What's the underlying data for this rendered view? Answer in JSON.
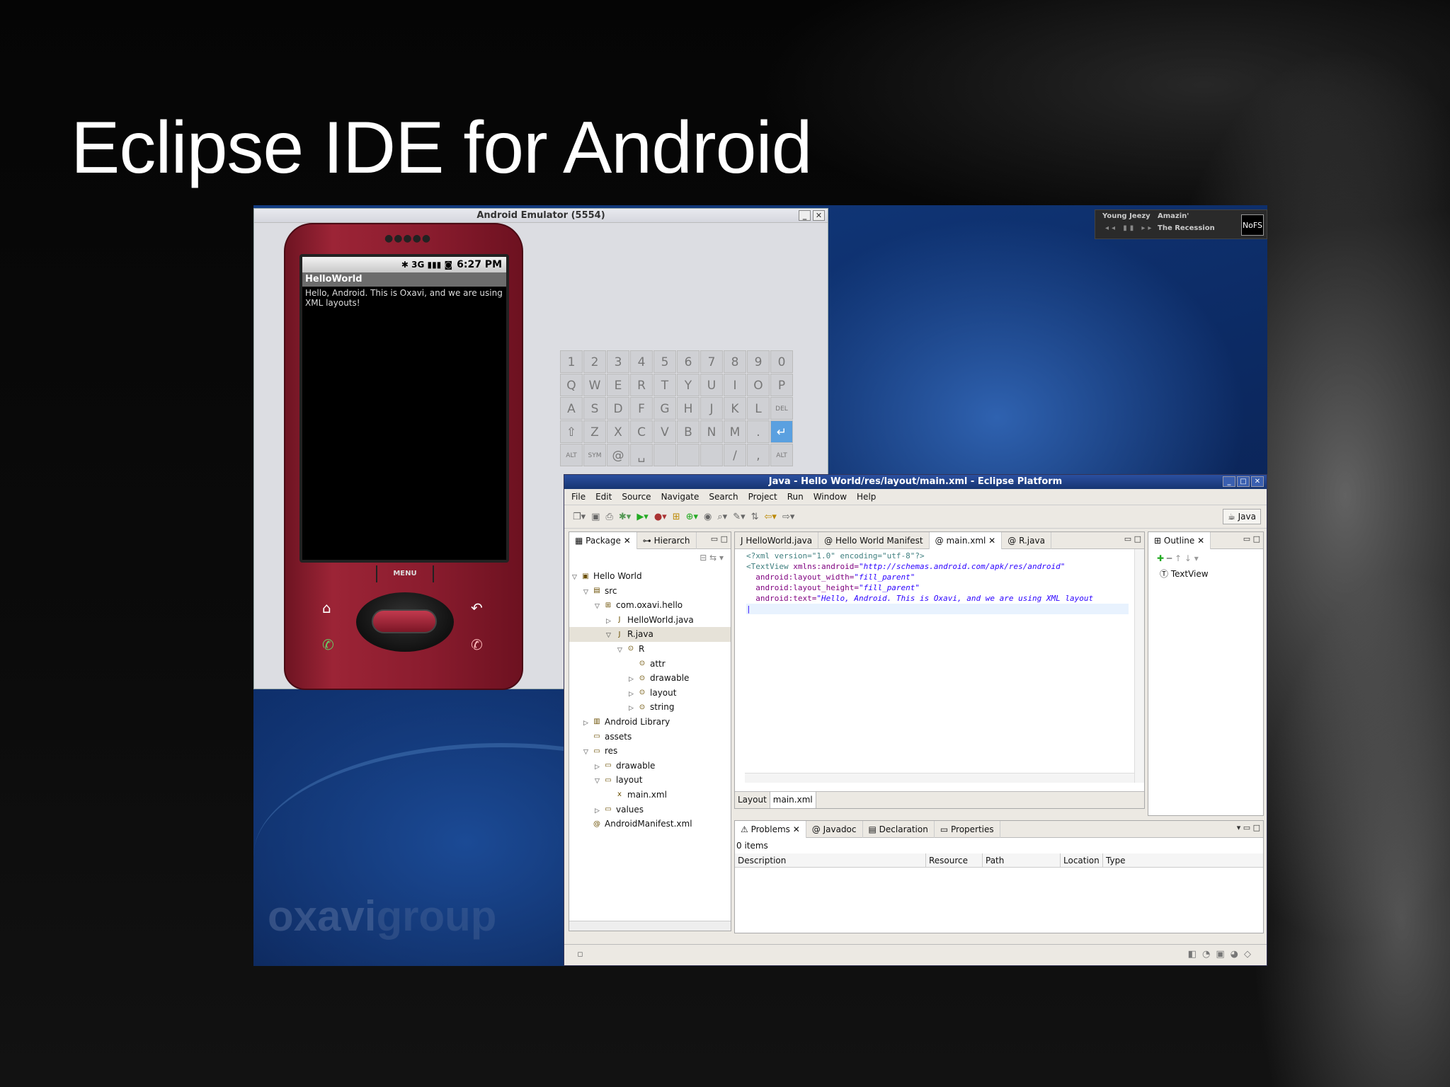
{
  "slide": {
    "title": "Eclipse IDE for Android"
  },
  "music": {
    "artist": "Young Jeezy",
    "song": "Amazin'",
    "album": "The Recession",
    "logo": "NoFS",
    "controls": "◂◂ ▮▮ ▸▸"
  },
  "brand": {
    "part1": "oxavi",
    "part2": "group"
  },
  "emulator": {
    "title": "Android Emulator (5554)",
    "time": "6:27 PM",
    "status_icons": "✱ 3G ▮▮▮ ◙",
    "app_title": "HelloWorld",
    "app_text": "Hello, Android. This is Oxavi, and we are using XML layouts!",
    "menu_label": "MENU",
    "keys": [
      [
        "1",
        "2",
        "3",
        "4",
        "5",
        "6",
        "7",
        "8",
        "9",
        "0"
      ],
      [
        "Q",
        "W",
        "E",
        "R",
        "T",
        "Y",
        "U",
        "I",
        "O",
        "P"
      ],
      [
        "A",
        "S",
        "D",
        "F",
        "G",
        "H",
        "J",
        "K",
        "L",
        "DEL"
      ],
      [
        "⇧",
        "Z",
        "X",
        "C",
        "V",
        "B",
        "N",
        "M",
        ".",
        "↵"
      ],
      [
        "ALT",
        "SYM",
        "@",
        "␣",
        "",
        "",
        "",
        "/",
        ",",
        "ALT"
      ]
    ]
  },
  "eclipse": {
    "title": "Java - Hello World/res/layout/main.xml - Eclipse Platform",
    "menu": [
      "File",
      "Edit",
      "Source",
      "Navigate",
      "Search",
      "Project",
      "Run",
      "Window",
      "Help"
    ],
    "perspective": "Java",
    "left_tabs": [
      "Package",
      "Hierarch"
    ],
    "tree": [
      {
        "level": 0,
        "twisty": "▽",
        "icon": "▣",
        "label": "Hello World"
      },
      {
        "level": 1,
        "twisty": "▽",
        "icon": "▤",
        "label": "src"
      },
      {
        "level": 2,
        "twisty": "▽",
        "icon": "⊞",
        "label": "com.oxavi.hello"
      },
      {
        "level": 3,
        "twisty": "▷",
        "icon": "J",
        "label": "HelloWorld.java"
      },
      {
        "level": 3,
        "twisty": "▽",
        "icon": "J",
        "label": "R.java",
        "selected": true
      },
      {
        "level": 4,
        "twisty": "▽",
        "icon": "⊙",
        "label": "R"
      },
      {
        "level": 5,
        "twisty": "",
        "icon": "⊙",
        "label": "attr"
      },
      {
        "level": 5,
        "twisty": "▷",
        "icon": "⊙",
        "label": "drawable"
      },
      {
        "level": 5,
        "twisty": "▷",
        "icon": "⊙",
        "label": "layout"
      },
      {
        "level": 5,
        "twisty": "▷",
        "icon": "⊙",
        "label": "string"
      },
      {
        "level": 1,
        "twisty": "▷",
        "icon": "▥",
        "label": "Android Library"
      },
      {
        "level": 1,
        "twisty": "",
        "icon": "▭",
        "label": "assets"
      },
      {
        "level": 1,
        "twisty": "▽",
        "icon": "▭",
        "label": "res"
      },
      {
        "level": 2,
        "twisty": "▷",
        "icon": "▭",
        "label": "drawable"
      },
      {
        "level": 2,
        "twisty": "▽",
        "icon": "▭",
        "label": "layout"
      },
      {
        "level": 3,
        "twisty": "",
        "icon": "x",
        "label": "main.xml"
      },
      {
        "level": 2,
        "twisty": "▷",
        "icon": "▭",
        "label": "values"
      },
      {
        "level": 1,
        "twisty": "",
        "icon": "@",
        "label": "AndroidManifest.xml"
      }
    ],
    "editor_tabs": [
      "HelloWorld.java",
      "Hello World Manifest",
      "main.xml",
      "R.java"
    ],
    "code": {
      "l1": "<?xml version=\"1.0\" encoding=\"utf-8\"?>",
      "l2a": "<TextView",
      "l2b": " xmlns:android=",
      "l2c": "\"http://schemas.android.com/apk/res/android\"",
      "l3a": "  android:layout_width=",
      "l3b": "\"fill_parent\"",
      "l4a": "  android:layout_height=",
      "l4b": "\"fill_parent\"",
      "l5a": "  android:text=",
      "l5b": "\"Hello, Android. This is Oxavi, and we are using XML layout"
    },
    "editor_bottom_tabs": [
      "Layout",
      "main.xml"
    ],
    "outline": {
      "tab": "Outline",
      "item": "TextView"
    },
    "bottom_tabs": [
      "Problems",
      "Javadoc",
      "Declaration",
      "Properties"
    ],
    "items_count": "0 items",
    "problem_columns": [
      "Description",
      "Resource",
      "Path",
      "Location",
      "Type"
    ]
  }
}
